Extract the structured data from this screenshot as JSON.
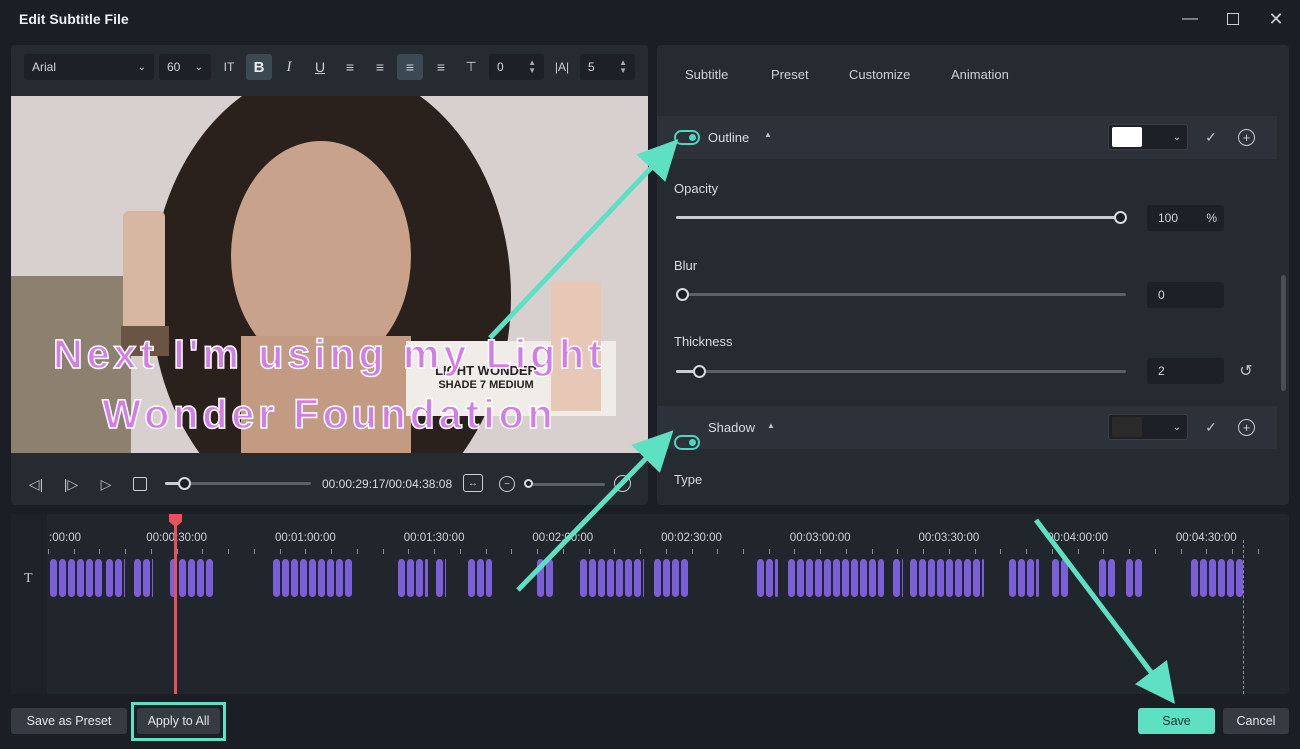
{
  "window": {
    "title": "Edit Subtitle File"
  },
  "toolbar": {
    "font": "Arial",
    "size": "60",
    "spacing_value": "0",
    "line_spacing_value": "5"
  },
  "video": {
    "subtitle_line1": "Next I'm using my Light",
    "subtitle_line2": "Wonder Foundation",
    "product_line1": "LIGHT WONDER",
    "product_line2": "SHADE 7 MEDIUM"
  },
  "playback": {
    "timecode": "00:00:29:17/00:04:38:08",
    "progress": 0.1
  },
  "tabs": [
    "Subtitle",
    "Preset",
    "Customize",
    "Animation"
  ],
  "outline": {
    "label": "Outline",
    "color": "#ffffff",
    "opacity_label": "Opacity",
    "opacity_value": "100",
    "opacity_unit": "%",
    "blur_label": "Blur",
    "blur_value": "0",
    "thickness_label": "Thickness",
    "thickness_value": "2"
  },
  "shadow": {
    "label": "Shadow",
    "color": "#2a2a2a",
    "type_label": "Type"
  },
  "timeline": {
    "ticks": [
      ":00:00",
      "00:00:30:00",
      "00:01:00:00",
      "00:01:30:00",
      "00:02:00:00",
      "00:02:30:00",
      "00:03:00:00",
      "00:03:30:00",
      "00:04:00:00",
      "00:04:30:00"
    ],
    "track_icon": "T"
  },
  "footer": {
    "save_preset": "Save as Preset",
    "apply_all": "Apply to All",
    "save": "Save",
    "cancel": "Cancel"
  },
  "colors": {
    "accent": "#5ee0c3",
    "clip": "#7b5fd8",
    "playhead": "#e8505b"
  }
}
